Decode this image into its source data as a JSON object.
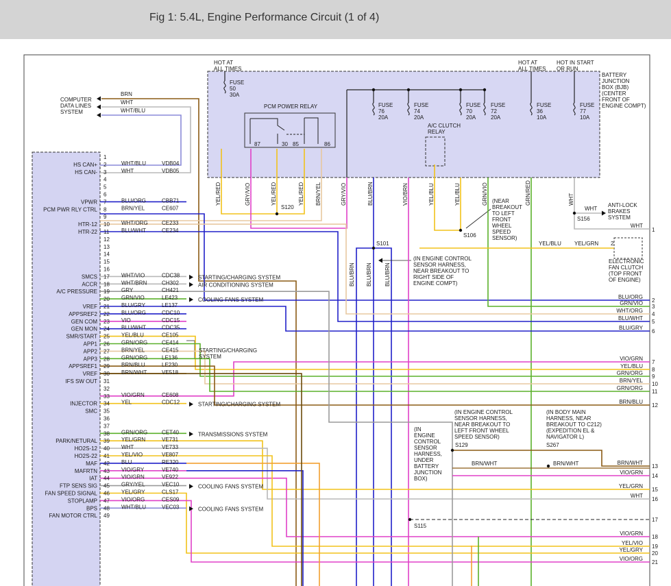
{
  "figure_title": "Fig 1: 5.4L, Engine Performance Circuit (1 of 4)",
  "colors": {
    "brown": "#8a5a14",
    "white": "#b8b8b8",
    "wht_blu": "#8a8ad8",
    "blue": "#2020c8",
    "yellow": "#f2c21a",
    "violet": "#e040c8",
    "green": "#5ab02a",
    "gray": "#9a9a9a",
    "orange": "#f2a030",
    "tan": "#e8c8a0",
    "bjb_fill": "#d7d7f3",
    "pcm_fill": "#d4d4f2",
    "dark_brown": "#6b4a0a"
  },
  "top_labels": {
    "hot_all_1": [
      "HOT AT",
      "ALL TIMES"
    ],
    "hot_all_2": [
      "HOT AT",
      "ALL TIMES"
    ],
    "hot_start": [
      "HOT IN START",
      "OR RUN"
    ],
    "bjb": [
      "BATTERY",
      "JUNCTION",
      "BOX (BJB)",
      "(CENTER",
      "FRONT OF",
      "ENGINE COMPT)"
    ],
    "pcm_relay": "PCM POWER RELAY",
    "ac_relay": [
      "A/C CLUTCH",
      "RELAY"
    ],
    "computer": [
      "COMPUTER",
      "DATA LINES",
      "SYSTEM"
    ]
  },
  "fuses": [
    {
      "lines": [
        "FUSE",
        "50",
        "30A"
      ]
    },
    {
      "lines": [
        "FUSE",
        "76",
        "20A"
      ]
    },
    {
      "lines": [
        "FUSE",
        "74",
        "20A"
      ]
    },
    {
      "lines": [
        "FUSE",
        "70",
        "20A"
      ]
    },
    {
      "lines": [
        "FUSE",
        "72",
        "20A"
      ]
    },
    {
      "lines": [
        "FUSE",
        "36",
        "10A"
      ]
    },
    {
      "lines": [
        "FUSE",
        "77",
        "10A"
      ]
    }
  ],
  "relay_pins": [
    "87",
    "30",
    "85",
    "86"
  ],
  "vertical_wire_labels": [
    "YEL/RED",
    "GRY/VIO",
    "YEL/RED",
    "YEL/RED",
    "BRN/YEL",
    "GRY/VIO",
    "BLU/BRN",
    "VIO/BRN",
    "YEL/BLU",
    "YEL/BLU",
    "GRN/VIO",
    "GRN/RED",
    "WHT"
  ],
  "lower_vertical_labels": [
    "BLU/BRN",
    "BLU/BRN",
    "BLU/BRN"
  ],
  "splices": {
    "s120": "S120",
    "s101": "S101",
    "s106": "S106",
    "s156": "S156",
    "s129": "S129",
    "s267": "S267",
    "s115": "S115"
  },
  "notes": {
    "s106": [
      "(NEAR",
      "BREAKOUT",
      "TO LEFT",
      "FRONT",
      "WHEEL",
      "SPEED",
      "SENSOR)"
    ],
    "s101": [
      "(IN ENGINE CONTROL",
      "SENSOR HARNESS,",
      "NEAR BREAKOUT TO",
      "RIGHT SIDE OF",
      "ENGINE COMPT)"
    ],
    "s129": [
      "(IN ENGINE CONTROL",
      "SENSOR HARNESS,",
      "NEAR BREAKOUT TO",
      "LEFT FRONT WHEEL",
      "SPEED SENSOR)"
    ],
    "s267": [
      "(IN BODY MAIN",
      "HARNESS, NEAR",
      "BREAKOUT TO C212)",
      "(EXPEDITION EL &",
      "NAVIGATOR L)"
    ],
    "s115": [
      "(IN",
      "ENGINE",
      "CONTROL",
      "SENSOR",
      "HARNESS,",
      "UNDER",
      "BATTERY",
      "JUNCTION",
      "BOX)"
    ],
    "abs": [
      "ANTI-LOCK",
      "BRAKES",
      "SYSTEM"
    ],
    "fan_clutch": [
      "ELECTRONIC",
      "FAN CLUTCH",
      "(TOP FRONT",
      "OF ENGINE)"
    ]
  },
  "misc_labels": {
    "brn": "BRN",
    "wht": "WHT",
    "wht_blu": "WHT/BLU",
    "abs_wire": "WHT",
    "abs_wht": "WHT",
    "abs_pin": "1",
    "yel_blu": "YEL/BLU",
    "yel_grn": "YEL/GRN",
    "pin2": "2",
    "brn_wht_1": "BRN/WHT",
    "brn_wht_2": "BRN/WHT"
  },
  "pcm_pins": [
    {
      "pin": "1",
      "name": "",
      "color": "",
      "circuit": "",
      "dest": ""
    },
    {
      "pin": "2",
      "name": "HS CAN+",
      "color": "WHT/BLU",
      "circuit": "VDB04",
      "dest": ""
    },
    {
      "pin": "3",
      "name": "HS CAN-",
      "color": "WHT",
      "circuit": "VDB05",
      "dest": ""
    },
    {
      "pin": "4",
      "name": "",
      "color": "",
      "circuit": "",
      "dest": ""
    },
    {
      "pin": "5",
      "name": "",
      "color": "",
      "circuit": "",
      "dest": ""
    },
    {
      "pin": "6",
      "name": "",
      "color": "",
      "circuit": "",
      "dest": ""
    },
    {
      "pin": "7",
      "name": "VPWR",
      "color": "BLU/ORG",
      "circuit": "CBB71",
      "dest": ""
    },
    {
      "pin": "8",
      "name": "PCM PWR RLY CTRL",
      "color": "BRN/YEL",
      "circuit": "CE607",
      "dest": ""
    },
    {
      "pin": "9",
      "name": "",
      "color": "",
      "circuit": "",
      "dest": ""
    },
    {
      "pin": "10",
      "name": "HTR-12",
      "color": "WHT/ORG",
      "circuit": "CE233",
      "dest": ""
    },
    {
      "pin": "11",
      "name": "HTR-22",
      "color": "BLU/WHT",
      "circuit": "CE234",
      "dest": ""
    },
    {
      "pin": "12",
      "name": "",
      "color": "",
      "circuit": "",
      "dest": ""
    },
    {
      "pin": "13",
      "name": "",
      "color": "",
      "circuit": "",
      "dest": ""
    },
    {
      "pin": "14",
      "name": "",
      "color": "",
      "circuit": "",
      "dest": ""
    },
    {
      "pin": "15",
      "name": "",
      "color": "",
      "circuit": "",
      "dest": ""
    },
    {
      "pin": "16",
      "name": "",
      "color": "",
      "circuit": "",
      "dest": ""
    },
    {
      "pin": "17",
      "name": "SMCS",
      "color": "WHT/VIO",
      "circuit": "CDC38",
      "dest": "STARTING/CHARGING SYSTEM"
    },
    {
      "pin": "18",
      "name": "ACCR",
      "color": "WHT/BRN",
      "circuit": "CH302",
      "dest": "AIR CONDITIONING SYSTEM"
    },
    {
      "pin": "19",
      "name": "A/C PRESSURE",
      "color": "GRY",
      "circuit": "CH421",
      "dest": ""
    },
    {
      "pin": "20",
      "name": "",
      "color": "GRN/VIO",
      "circuit": "LE423",
      "dest": "COOLING FANS SYSTEM"
    },
    {
      "pin": "21",
      "name": "VREF",
      "color": "BLU/GRY",
      "circuit": "LE137",
      "dest": ""
    },
    {
      "pin": "22",
      "name": "APPSREF2",
      "color": "BLU/ORG",
      "circuit": "CDC10",
      "dest": ""
    },
    {
      "pin": "23",
      "name": "GEN COM",
      "color": "VIO",
      "circuit": "CDC15",
      "dest": ""
    },
    {
      "pin": "24",
      "name": "GEN MON",
      "color": "BLU/WHT",
      "circuit": "CDC35",
      "dest": ""
    },
    {
      "pin": "25",
      "name": "SMR/START",
      "color": "YEL/BLU",
      "circuit": "CE105",
      "dest": ""
    },
    {
      "pin": "26",
      "name": "APP1",
      "color": "GRN/ORG",
      "circuit": "CE414",
      "dest": ""
    },
    {
      "pin": "27",
      "name": "APP2",
      "color": "BRN/YEL",
      "circuit": "CE415",
      "dest": ""
    },
    {
      "pin": "28",
      "name": "APP3",
      "color": "GRN/ORG",
      "circuit": "LE136",
      "dest": ""
    },
    {
      "pin": "29",
      "name": "APPSREF1",
      "color": "BRN/BLU",
      "circuit": "LE230",
      "dest": ""
    },
    {
      "pin": "30",
      "name": "VREF",
      "color": "BRN/WHT",
      "circuit": "VE518",
      "dest": ""
    },
    {
      "pin": "31",
      "name": "IFS SW OUT",
      "color": "",
      "circuit": "",
      "dest": ""
    },
    {
      "pin": "32",
      "name": "",
      "color": "",
      "circuit": "",
      "dest": ""
    },
    {
      "pin": "33",
      "name": "",
      "color": "VIO/GRN",
      "circuit": "CE608",
      "dest": ""
    },
    {
      "pin": "34",
      "name": "INJECTOR",
      "color": "YEL",
      "circuit": "CDC12",
      "dest": "STARTING/CHARGING SYSTEM"
    },
    {
      "pin": "35",
      "name": "SMC",
      "color": "",
      "circuit": "",
      "dest": ""
    },
    {
      "pin": "36",
      "name": "",
      "color": "",
      "circuit": "",
      "dest": ""
    },
    {
      "pin": "37",
      "name": "",
      "color": "",
      "circuit": "",
      "dest": ""
    },
    {
      "pin": "38",
      "name": "",
      "color": "GRN/ORG",
      "circuit": "CET40",
      "dest": "TRANSMISSIONS SYSTEM"
    },
    {
      "pin": "39",
      "name": "PARK/NETURAL",
      "color": "YEL/GRN",
      "circuit": "VE731",
      "dest": ""
    },
    {
      "pin": "40",
      "name": "HO2S-12",
      "color": "WHT",
      "circuit": "VE733",
      "dest": ""
    },
    {
      "pin": "41",
      "name": "HO2S-22",
      "color": "YEL/VIO",
      "circuit": "VE807",
      "dest": ""
    },
    {
      "pin": "42",
      "name": "MAF",
      "color": "BLU",
      "circuit": "RE320",
      "dest": ""
    },
    {
      "pin": "43",
      "name": "MAFRTN",
      "color": "VIO/GRY",
      "circuit": "VE740",
      "dest": ""
    },
    {
      "pin": "44",
      "name": "IAT",
      "color": "VIO/GRN",
      "circuit": "VE922",
      "dest": ""
    },
    {
      "pin": "45",
      "name": "FTP SENS SIG",
      "color": "GRY/YEL",
      "circuit": "VEC10",
      "dest": "COOLING FANS SYSTEM"
    },
    {
      "pin": "46",
      "name": "FAN SPEED SIGNAL",
      "color": "YEL/GRY",
      "circuit": "CLS17",
      "dest": ""
    },
    {
      "pin": "47",
      "name": "STOPLAMP",
      "color": "VIO/ORG",
      "circuit": "CES09",
      "dest": ""
    },
    {
      "pin": "48",
      "name": "BPS",
      "color": "WHT/BLU",
      "circuit": "VEC03",
      "dest": "COOLING FANS SYSTEM"
    },
    {
      "pin": "49",
      "name": "FAN MOTOR CTRL",
      "color": "",
      "circuit": "",
      "dest": ""
    }
  ],
  "starting_group": [
    "STARTING/CHARGING",
    "SYSTEM"
  ],
  "right_pins": [
    {
      "num": "1",
      "label": "WHT"
    },
    {
      "num": "2",
      "label": "BLU/ORG"
    },
    {
      "num": "3",
      "label": "GRN/VIO"
    },
    {
      "num": "4",
      "label": "WHT/ORG"
    },
    {
      "num": "5",
      "label": "BLU/WHT"
    },
    {
      "num": "6",
      "label": "BLU/GRY"
    },
    {
      "num": "7",
      "label": "VIO/GRN"
    },
    {
      "num": "8",
      "label": "YEL/BLU"
    },
    {
      "num": "9",
      "label": "GRN/ORG"
    },
    {
      "num": "10",
      "label": "BRN/YEL"
    },
    {
      "num": "11",
      "label": "GRN/ORG"
    },
    {
      "num": "12",
      "label": "BRN/BLU"
    },
    {
      "num": "13",
      "label": "BRN/WHT"
    },
    {
      "num": "14",
      "label": "VIO/GRN"
    },
    {
      "num": "15",
      "label": "YEL/GRN"
    },
    {
      "num": "16",
      "label": "WHT"
    },
    {
      "num": "17",
      "label": ""
    },
    {
      "num": "18",
      "label": "VIO/GRN"
    },
    {
      "num": "19",
      "label": "YEL/VIO"
    },
    {
      "num": "20",
      "label": "YEL/GRY"
    },
    {
      "num": "21",
      "label": "VIO/ORG"
    }
  ]
}
